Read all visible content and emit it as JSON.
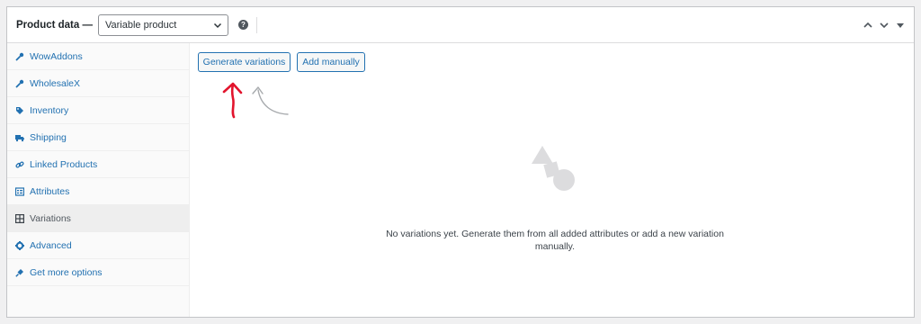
{
  "header": {
    "title": "Product data —",
    "product_type": "Variable product",
    "help_glyph": "?"
  },
  "sidebar": {
    "items": [
      {
        "label": "WowAddons",
        "icon": "wrench-icon",
        "active": false
      },
      {
        "label": "WholesaleX",
        "icon": "wrench-icon",
        "active": false
      },
      {
        "label": "Inventory",
        "icon": "tag-icon",
        "active": false
      },
      {
        "label": "Shipping",
        "icon": "truck-icon",
        "active": false
      },
      {
        "label": "Linked Products",
        "icon": "link-icon",
        "active": false
      },
      {
        "label": "Attributes",
        "icon": "list-icon",
        "active": false
      },
      {
        "label": "Variations",
        "icon": "grid-icon",
        "active": true
      },
      {
        "label": "Advanced",
        "icon": "gear-icon",
        "active": false
      },
      {
        "label": "Get more options",
        "icon": "plugin-icon",
        "active": false
      }
    ]
  },
  "main": {
    "generate_label": "Generate variations",
    "add_manually_label": "Add manually",
    "empty_message": "No variations yet. Generate them from all added attributes or add a new variation manually."
  },
  "colors": {
    "accent": "#2271b1",
    "annotation_arrow": "#e2142d"
  }
}
